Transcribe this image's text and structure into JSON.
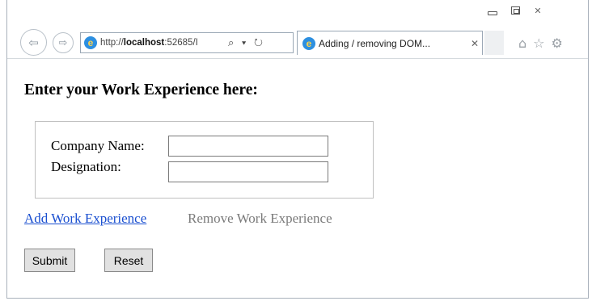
{
  "browser": {
    "address_url_host": "http://",
    "address_url_bold": "localhost",
    "address_url_rest": ":52685/I",
    "address_icons": "⌕ ▾ ↻",
    "tab_title": "Adding / removing DOM...",
    "tab_close": "✕",
    "window_close": "✕",
    "toolbar_icons": [
      "home-icon",
      "star-icon",
      "gear-icon"
    ]
  },
  "page": {
    "heading": "Enter your Work Experience here:",
    "company_label": "Company Name:",
    "company_value": "",
    "designation_label": "Designation:",
    "designation_value": "",
    "add_link": "Add Work Experience",
    "remove_link": "Remove Work Experience",
    "submit_label": "Submit",
    "reset_label": "Reset"
  },
  "colors": {
    "link": "#1a4fd0",
    "disabled_link": "#7a7a7a",
    "button_bg": "#e1e1e1"
  }
}
